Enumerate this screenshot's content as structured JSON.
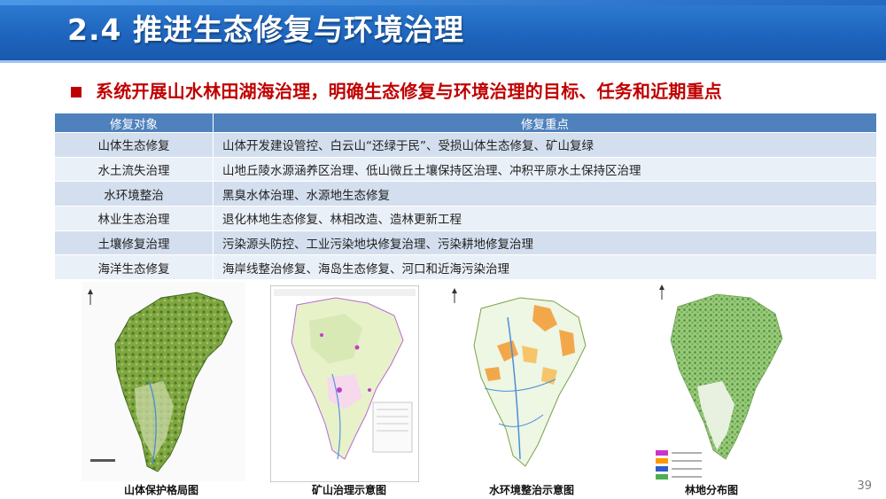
{
  "header": {
    "title": "2.4 推进生态修复与环境治理"
  },
  "subtitle": "系统开展山水林田湖海治理，明确生态修复与环境治理的目标、任务和近期重点",
  "table": {
    "headers": [
      "修复对象",
      "修复重点"
    ],
    "rows": [
      {
        "object": "山体生态修复",
        "focus": "山体开发建设管控、白云山“还绿于民”、受损山体生态修复、矿山复绿"
      },
      {
        "object": "水土流失治理",
        "focus": "山地丘陵水源涵养区治理、低山微丘土壤保持区治理、冲积平原水土保持区治理"
      },
      {
        "object": "水环境整治",
        "focus": "黑臭水体治理、水源地生态修复"
      },
      {
        "object": "林业生态治理",
        "focus": "退化林地生态修复、林相改造、造林更新工程"
      },
      {
        "object": "土壤修复治理",
        "focus": "污染源头防控、工业污染地块修复治理、污染耕地修复治理"
      },
      {
        "object": "海洋生态修复",
        "focus": "海岸线整治修复、海岛生态修复、河口和近海污染治理"
      }
    ]
  },
  "maps": [
    {
      "caption": "山体保护格局图",
      "icon": "mountain-map"
    },
    {
      "caption": "矿山治理示意图",
      "icon": "mine-map"
    },
    {
      "caption": "水环境整治示意图",
      "icon": "water-map"
    },
    {
      "caption": "林地分布图",
      "icon": "forest-map"
    }
  ],
  "colors": {
    "header": "#1f66bf",
    "subtitle": "#c00000",
    "table_header": "#4f81bd",
    "row_odd": "#d3dfee",
    "row_even": "#eaf0f8",
    "legend": [
      "#cc33cc",
      "#ff9900",
      "#2e5fc9",
      "#4caf50"
    ]
  },
  "page_number": "39"
}
